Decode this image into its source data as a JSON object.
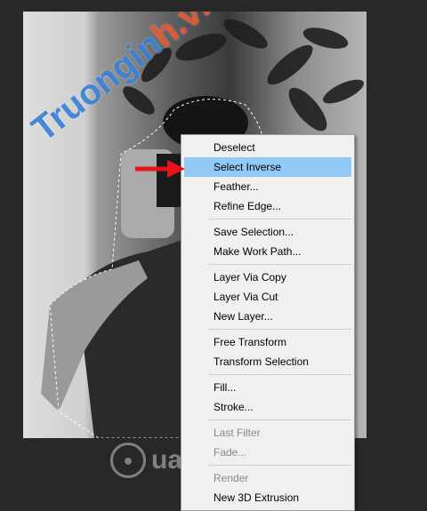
{
  "watermarks": {
    "diagonal_main": "Truongin",
    "diagonal_accent": "h.vn",
    "bottom": "uantrimang"
  },
  "menu": {
    "items": [
      {
        "label": "Deselect"
      },
      {
        "label": "Select Inverse"
      },
      {
        "label": "Feather..."
      },
      {
        "label": "Refine Edge..."
      },
      {
        "label": "Save Selection..."
      },
      {
        "label": "Make Work Path..."
      },
      {
        "label": "Layer Via Copy"
      },
      {
        "label": "Layer Via Cut"
      },
      {
        "label": "New Layer..."
      },
      {
        "label": "Free Transform"
      },
      {
        "label": "Transform Selection"
      },
      {
        "label": "Fill..."
      },
      {
        "label": "Stroke..."
      },
      {
        "label": "Last Filter"
      },
      {
        "label": "Fade..."
      },
      {
        "label": "Render"
      },
      {
        "label": "New 3D Extrusion"
      }
    ]
  },
  "colors": {
    "highlight": "#91c9f7",
    "arrow": "#e8121a",
    "background": "#282828"
  }
}
